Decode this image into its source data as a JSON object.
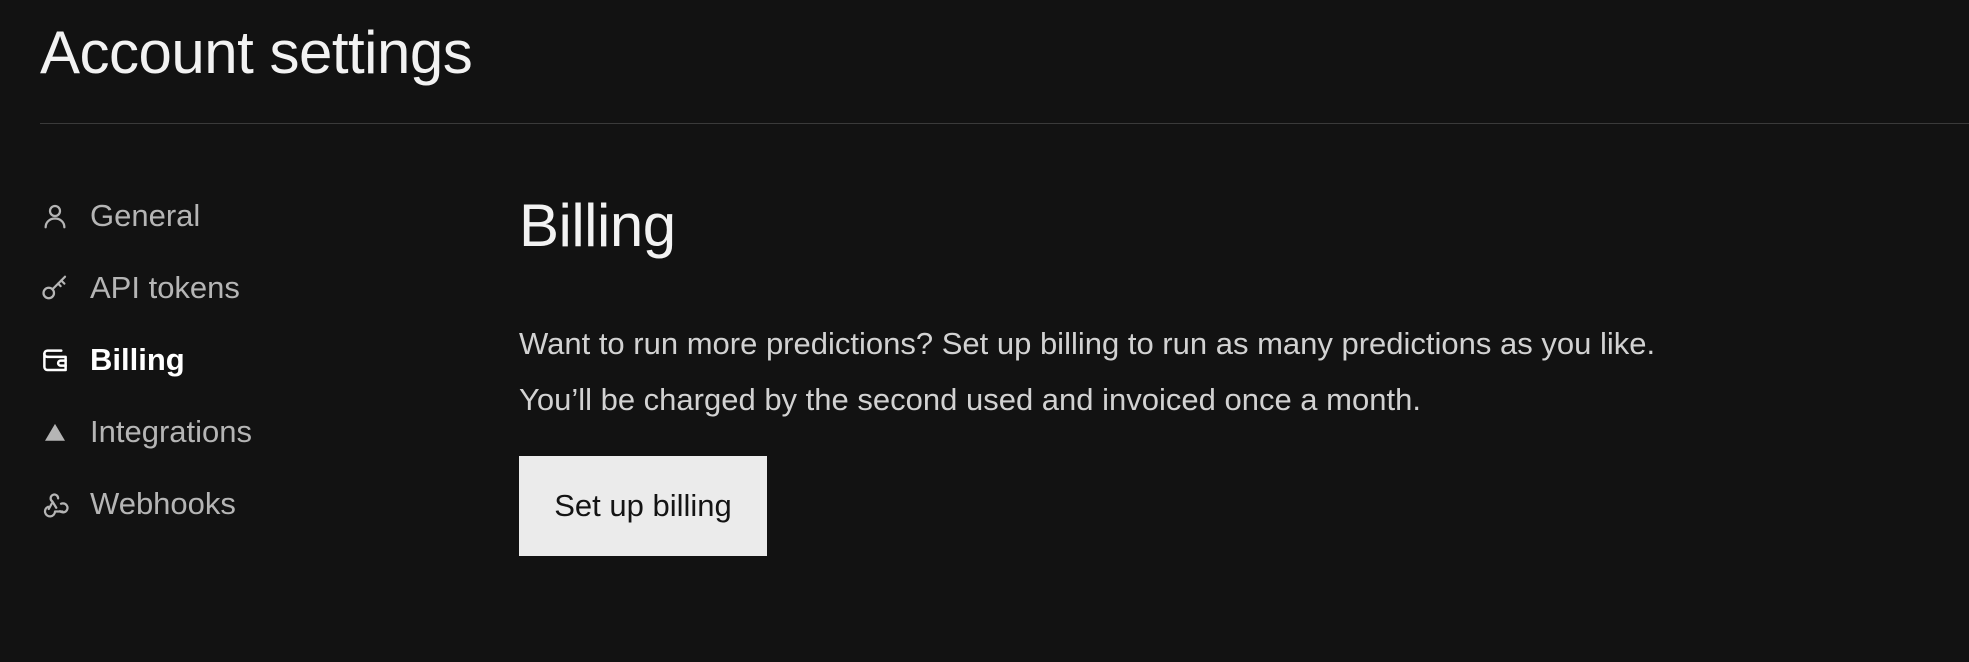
{
  "page": {
    "title": "Account settings"
  },
  "sidebar": {
    "items": [
      {
        "label": "General",
        "icon": "user-icon",
        "active": false
      },
      {
        "label": "API tokens",
        "icon": "key-icon",
        "active": false
      },
      {
        "label": "Billing",
        "icon": "wallet-icon",
        "active": true
      },
      {
        "label": "Integrations",
        "icon": "triangle-icon",
        "active": false
      },
      {
        "label": "Webhooks",
        "icon": "webhook-icon",
        "active": false
      }
    ]
  },
  "billing": {
    "title": "Billing",
    "description_line1": "Want to run more predictions? Set up billing to run as many predictions as you like.",
    "description_line2": "You’ll be charged by the second used and invoiced once a month.",
    "button_label": "Set up billing"
  },
  "colors": {
    "background": "#121212",
    "text_primary": "#f2f2f2",
    "text_muted": "#b5b5b5",
    "button_bg": "#ebebeb",
    "button_text": "#141414",
    "divider": "#3a3a3a"
  }
}
